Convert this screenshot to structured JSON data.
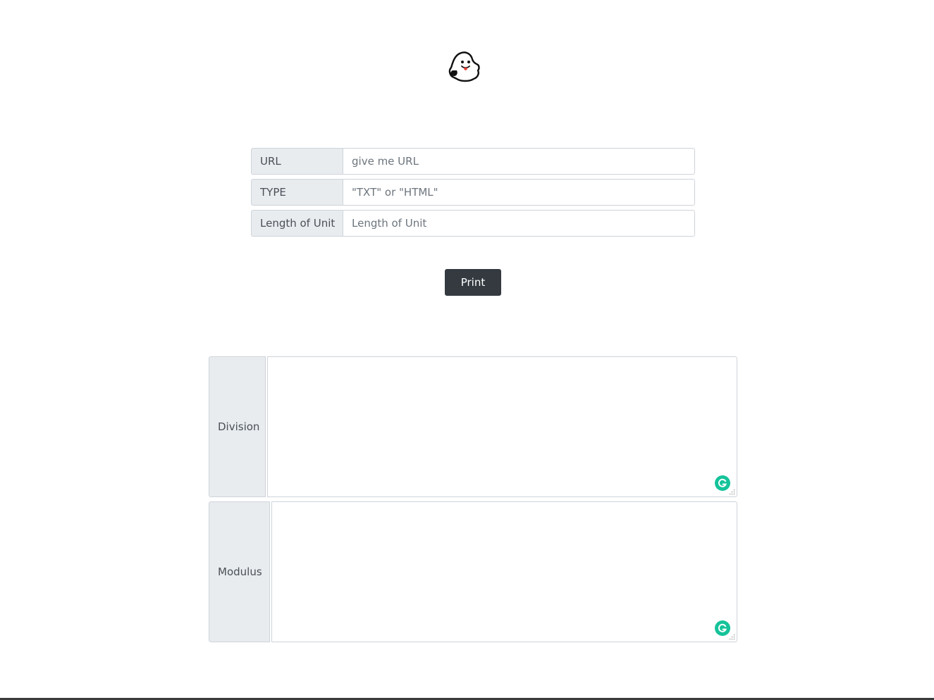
{
  "logo": {
    "icon": "ghost-icon"
  },
  "form": {
    "url": {
      "label": "URL",
      "placeholder": "give me URL",
      "value": ""
    },
    "type": {
      "label": "TYPE",
      "placeholder": "\"TXT\" or \"HTML\"",
      "value": ""
    },
    "unit": {
      "label": "Length of Unit",
      "placeholder": "Length of Unit",
      "value": ""
    }
  },
  "print_button": {
    "label": "Print",
    "color": "#343a40"
  },
  "results": {
    "division": {
      "label": "Division",
      "value": ""
    },
    "modulus": {
      "label": "Modulus",
      "value": ""
    }
  },
  "colors": {
    "addon_bg": "#e9ecef",
    "border": "#ced4da",
    "grammarly": "#15c39a"
  }
}
